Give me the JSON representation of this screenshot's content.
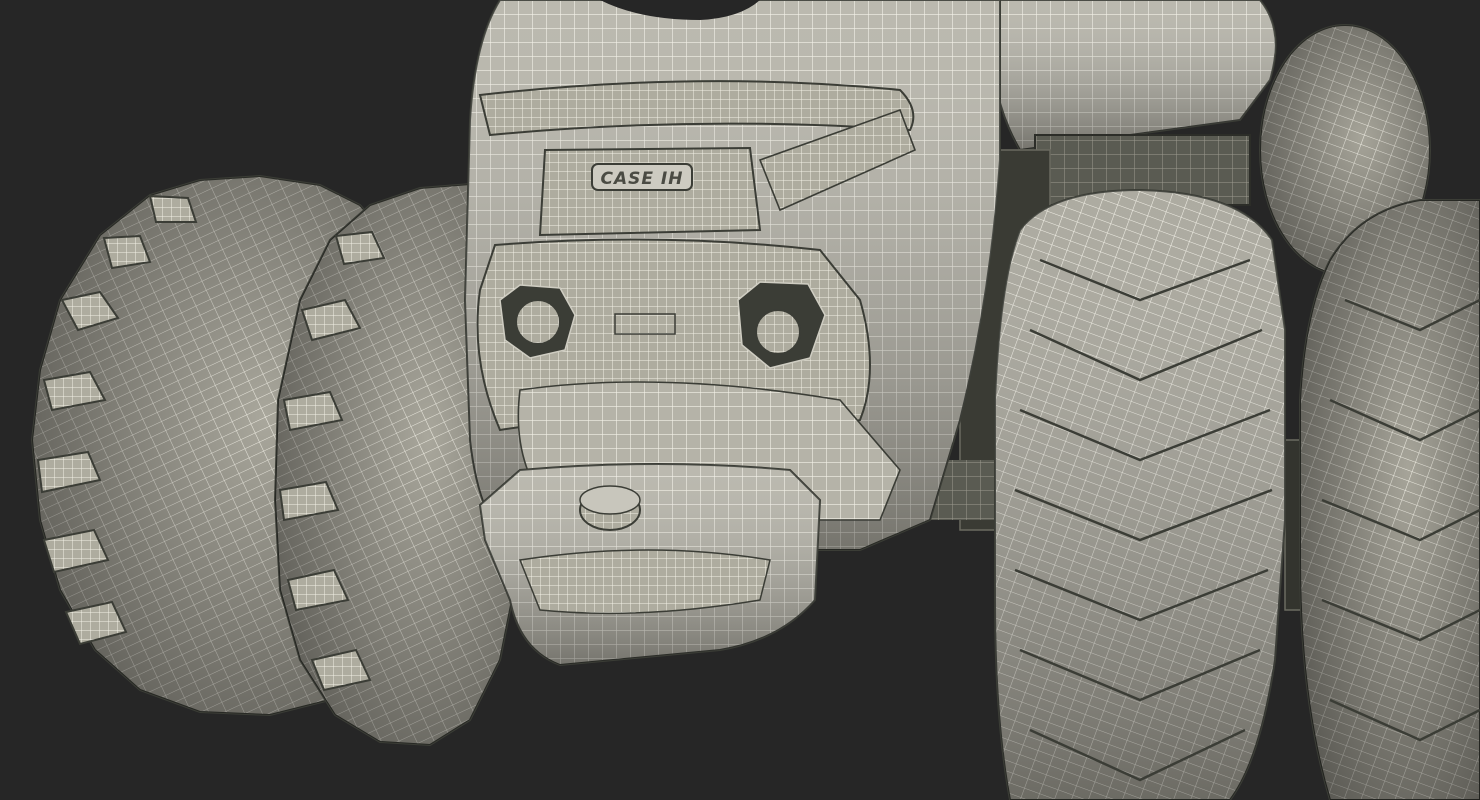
{
  "scene": {
    "description_type": "wireframe-render",
    "background_color": "#262626",
    "mesh_fill_color": "#b9b7ac",
    "mesh_shade_color": "#8f8d84",
    "wire_color": "#f4f2e8",
    "dark_recess_color": "#3b3d36"
  },
  "logo": {
    "text": "CASE IH"
  },
  "icons": [
    "tire-icon",
    "headlight-icon",
    "hood-icon",
    "front-weight-icon",
    "badge-icon"
  ]
}
